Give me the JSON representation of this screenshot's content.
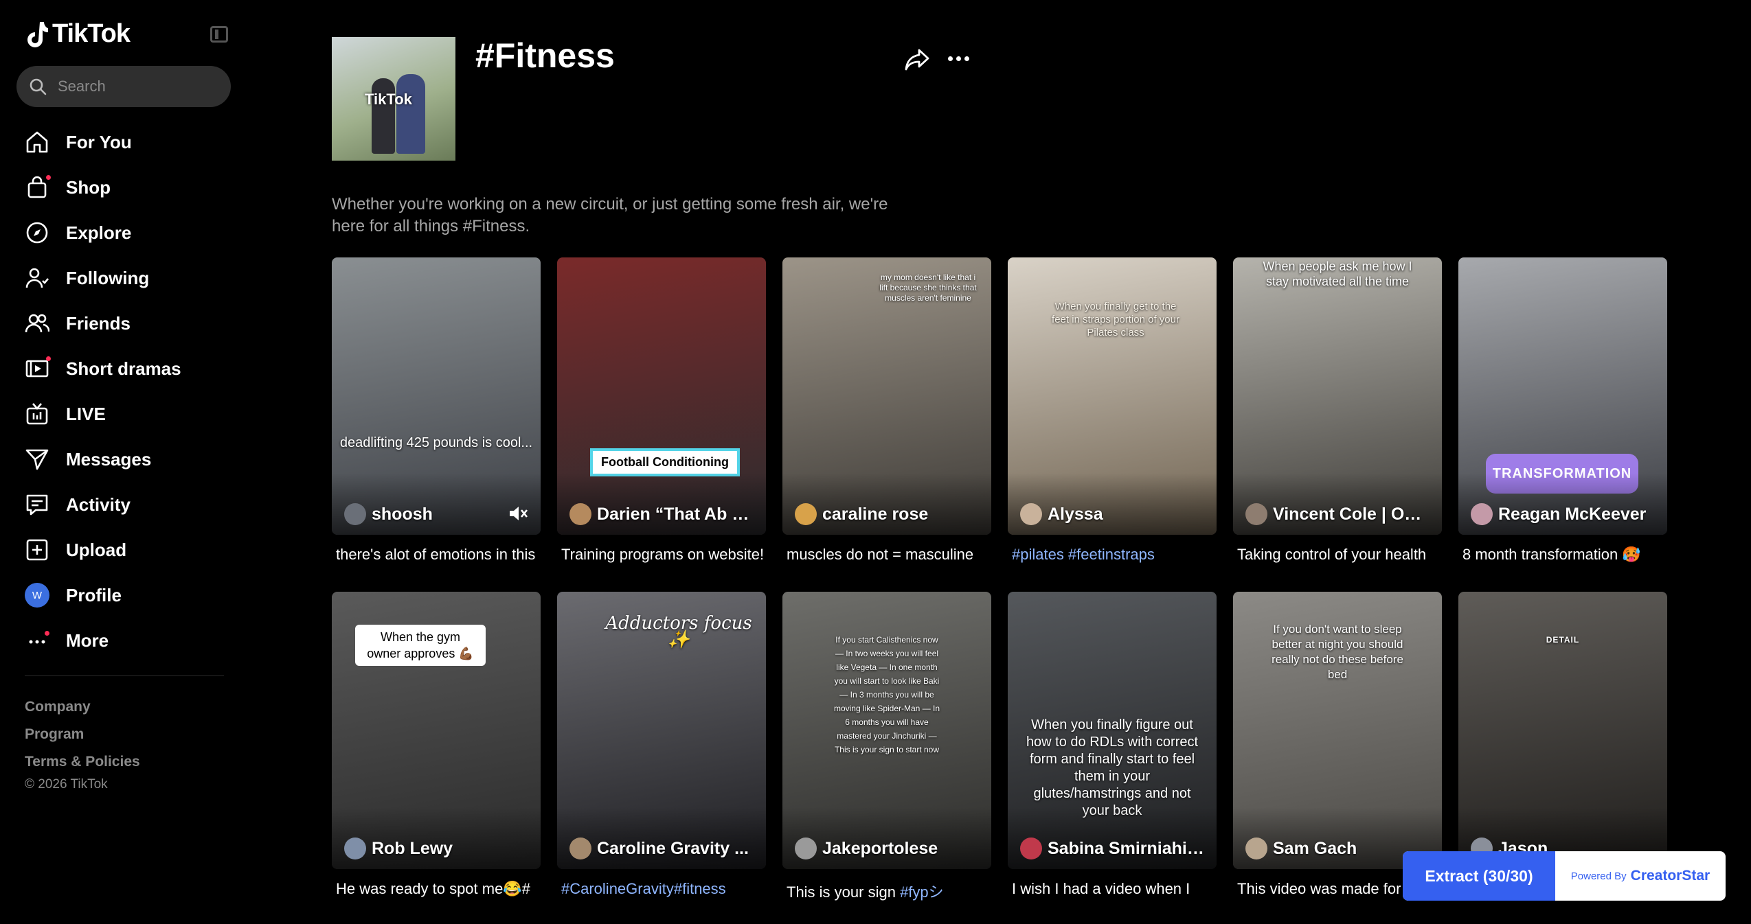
{
  "app": {
    "name": "TikTok"
  },
  "search": {
    "placeholder": "Search"
  },
  "nav": [
    {
      "label": "For You",
      "icon": "home-icon"
    },
    {
      "label": "Shop",
      "icon": "shopping-bag-icon"
    },
    {
      "label": "Explore",
      "icon": "compass-icon"
    },
    {
      "label": "Following",
      "icon": "user-follow-icon"
    },
    {
      "label": "Friends",
      "icon": "friends-icon"
    },
    {
      "label": "Short dramas",
      "icon": "film-icon"
    },
    {
      "label": "LIVE",
      "icon": "live-tv-icon"
    },
    {
      "label": "Messages",
      "icon": "send-icon"
    },
    {
      "label": "Activity",
      "icon": "inbox-icon"
    },
    {
      "label": "Upload",
      "icon": "plus-square-icon"
    },
    {
      "label": "Profile",
      "icon": "avatar",
      "avatar_letter": "W"
    },
    {
      "label": "More",
      "icon": "more-dots-icon"
    }
  ],
  "footer": {
    "links": [
      "Company",
      "Program",
      "Terms & Policies"
    ],
    "copyright": "© 2026 TikTok"
  },
  "header": {
    "cover_text": "TikTok",
    "title": "#Fitness",
    "description": "Whether you're working on a new circuit, or just getting some fresh air, we're here for all things #Fitness."
  },
  "videos": [
    {
      "creator": "shoosh",
      "caption": "there's alot of emotions in this",
      "overlay": "deadlifting 425 pounds is cool...",
      "bg1": "#8a8f92",
      "bg2": "#3c3f45",
      "avatar": "#6a6f78"
    },
    {
      "creator": "Darien “That Ab G...",
      "caption": "Training programs on website!",
      "overlay": "Football Conditioning",
      "bg1": "#7a2a2a",
      "bg2": "#2b2b2e",
      "avatar": "#b58a5e"
    },
    {
      "creator": "caraline rose",
      "caption": "muscles do not = masculine",
      "overlay": "my mom doesn't like that i lift because she thinks that muscles aren't feminine",
      "bg1": "#9c9488",
      "bg2": "#3d3a36",
      "avatar": "#d8a24a"
    },
    {
      "creator": "Alyssa",
      "caption": "",
      "caption_tag": "#pilates #feetinstraps",
      "overlay": "When you finally get to the feet in straps portion of your Pilates class",
      "bg1": "#d9d2c7",
      "bg2": "#6f6250",
      "avatar": "#c9b29b"
    },
    {
      "creator": "Vincent Cole | Onl...",
      "caption": "Taking control of your health",
      "overlay": "When people ask me how I stay motivated all the time",
      "bg1": "#b5b3ac",
      "bg2": "#3e3c38",
      "avatar": "#8e7d70"
    },
    {
      "creator": "Reagan McKeever",
      "caption": "8 month transformation 🥵",
      "overlay": "TRANSFORMATION",
      "bg1": "#a7a9ad",
      "bg2": "#3a3c42",
      "avatar": "#c49aa8"
    },
    {
      "creator": "Rob Lewy",
      "caption": "He was ready to spot me😂#",
      "overlay": "When the gym owner approves 💪🏾",
      "bg1": "#5a5a5a",
      "bg2": "#2a2a2a",
      "avatar": "#7f8fa8"
    },
    {
      "creator": "Caroline Gravity ...",
      "caption": "",
      "caption_tag": "#CarolineGravity#fitness",
      "overlay": "Adductors focus ✨",
      "bg1": "#6b6b70",
      "bg2": "#1e1e22",
      "avatar": "#a3896d"
    },
    {
      "creator": "Jakeportolese",
      "caption": "This is your sign ",
      "caption_tag_inline": "#fypシ",
      "overlay": "If you start Calisthenics now — In two weeks you will feel like Vegeta — In one month you will start to look like Baki — In 3 months you will be moving like Spider-Man — In 6 months you will have mastered your Jinchuriki — This is your sign to start now",
      "bg1": "#6e6e6a",
      "bg2": "#2c2c2a",
      "avatar": "#9a9a9a"
    },
    {
      "creator": "Sabina Smirniahin...",
      "caption": "I wish I had a video when I",
      "overlay": "When you finally figure out how to do RDLs with correct form and finally start to feel them in your glutes/hamstrings and not your back",
      "bg1": "#55585c",
      "bg2": "#1d1e20",
      "avatar": "#c0394b"
    },
    {
      "creator": "Sam Gach",
      "caption": "This video was made for",
      "overlay": "If you don't want to sleep better at night you should really not do these before bed",
      "bg1": "#8c8a86",
      "bg2": "#4a4844",
      "avatar": "#b8a58e"
    },
    {
      "creator": "Jason",
      "caption": "",
      "overlay": "DETAIL",
      "bg1": "#5f5c58",
      "bg2": "#1f1d1b",
      "avatar": "#8a8f9a"
    }
  ],
  "extension": {
    "button": "Extract (30/30)",
    "powered_by": "Powered By",
    "brand": "CreatorStar"
  },
  "colors": {
    "accent": "#fe2c55",
    "hashtag": "#8fb6ff",
    "extract_blue": "#3560f0"
  }
}
